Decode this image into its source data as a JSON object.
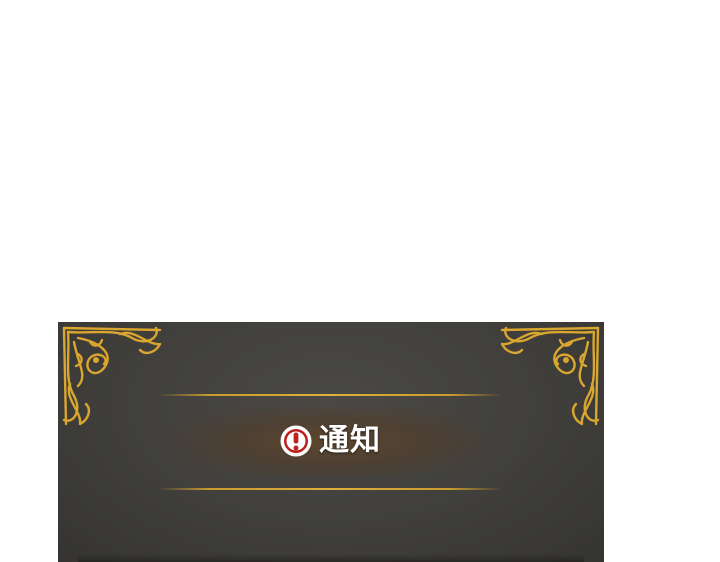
{
  "dialog": {
    "title": "通知",
    "alert_icon": "exclamation-circle-icon",
    "corner_ornament": "art-nouveau-gold-corner",
    "colors": {
      "panel": "#403f3b",
      "gold": "#d9a62f",
      "banner_glow": "#5f462d",
      "icon_red": "#b8211f",
      "title_text": "#ffffff"
    }
  }
}
